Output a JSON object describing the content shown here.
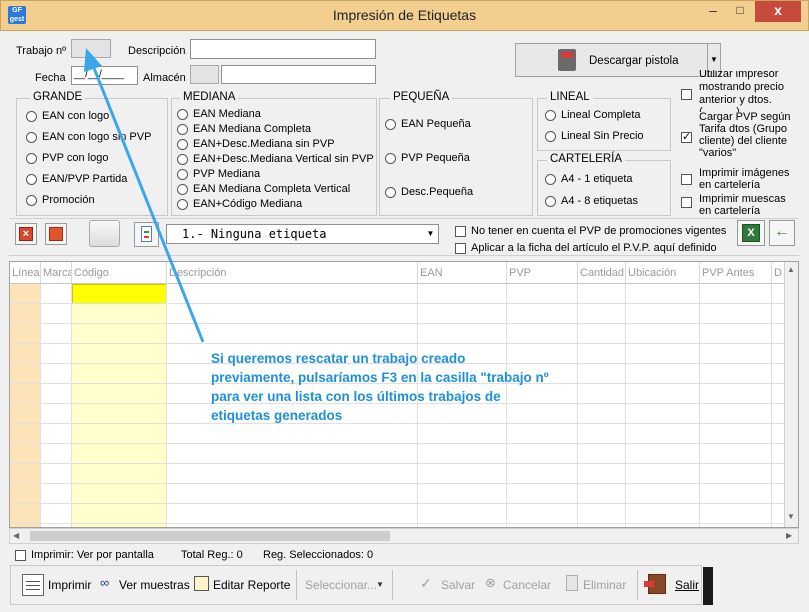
{
  "window": {
    "title": "Impresión de Etiquetas",
    "minimize": "–",
    "maximize": "□",
    "close": "x",
    "icon_text": "GF gest"
  },
  "header": {
    "trabajo_label": "Trabajo nº",
    "descripcion_label": "Descripción",
    "fecha_label": "Fecha",
    "fecha_value": "__/__/____",
    "almacen_label": "Almacén",
    "descargar_label": "Descargar pistola"
  },
  "grande": {
    "legend": "GRANDE",
    "options": [
      "EAN con logo",
      "EAN con logo sin PVP",
      "PVP con logo",
      "EAN/PVP Partida",
      "Promoción"
    ]
  },
  "mediana": {
    "legend": "MEDIANA",
    "options": [
      "EAN Mediana",
      "EAN Mediana Completa",
      "EAN+Desc.Mediana sin PVP",
      "EAN+Desc.Mediana Vertical sin PVP",
      "PVP Mediana",
      "EAN Mediana Completa Vertical",
      "EAN+Código Mediana"
    ]
  },
  "pequena": {
    "legend": "PEQUEÑA",
    "options": [
      "EAN Pequeña",
      "PVP Pequeña",
      "Desc.Pequeña"
    ]
  },
  "lineal": {
    "legend": "LINEAL",
    "options": [
      "Lineal Completa",
      "Lineal Sin Precio"
    ]
  },
  "carteleria": {
    "legend": "CARTELERÍA",
    "options": [
      "A4 - 1 etiqueta",
      "A4 - 8 etiquetas"
    ]
  },
  "right_options": {
    "opt1_partial": "Utilizar impresor",
    "opt1": "mostrando precio anterior y dtos.",
    "opt1_cut": "(... ... ...)",
    "opt2": "Cargar PVP según Tarifa dtos (Grupo cliente) del cliente \"varios\"",
    "opt3": "Imprimir imágenes en cartelería",
    "opt4": "Imprimir muescas en cartelería"
  },
  "toolbar": {
    "combo_value": "1.- Ninguna etiqueta",
    "check1": "No tener en cuenta el PVP de promociones vigentes",
    "check2": "Aplicar a la ficha del artículo el P.V.P. aquí definido"
  },
  "grid": {
    "columns": [
      "Línea",
      "Marca",
      "Código",
      "Descripción",
      "EAN",
      "PVP",
      "Cantidad",
      "Ubicación",
      "PVP Antes",
      "D"
    ]
  },
  "annotation": "Si queremos rescatar un trabajo creado previamente, pulsaríamos F3 en la casilla \"trabajo nº para ver una lista con los últimos trabajos de etiquetas generados",
  "status": {
    "imprimir_check": "Imprimir: Ver por pantalla",
    "total_reg": "Total Reg.: 0",
    "reg_sel": "Reg. Seleccionados: 0"
  },
  "bottom": {
    "imprimir": "Imprimir",
    "ver_muestras": "Ver muestras",
    "editar_reporte": "Editar Reporte",
    "seleccionar": "Seleccionar...",
    "salvar": "Salvar",
    "cancelar": "Cancelar",
    "eliminar": "Eliminar",
    "salir": "Salir"
  },
  "colors": {
    "accent_title": "#f3cf8f",
    "annotation": "#1e90d8",
    "grid_highlight": "#ffff00",
    "line_col": "#fde3b8",
    "code_col": "#ffffcc"
  }
}
